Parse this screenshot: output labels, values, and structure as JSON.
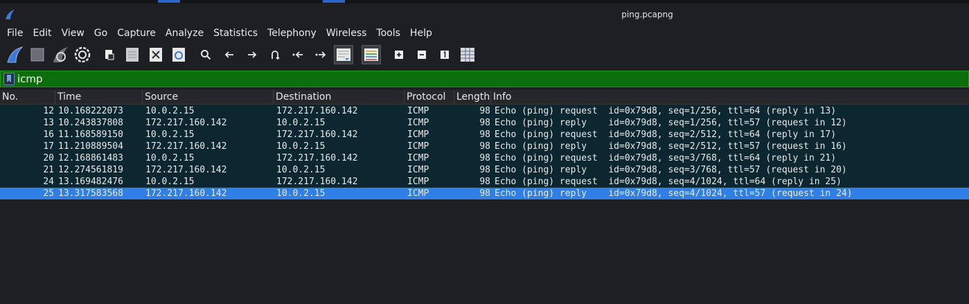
{
  "window": {
    "title": "ping.pcapng"
  },
  "menu": [
    "File",
    "Edit",
    "View",
    "Go",
    "Capture",
    "Analyze",
    "Statistics",
    "Telephony",
    "Wireless",
    "Tools",
    "Help"
  ],
  "toolbar": {
    "icons": [
      "shark-fin-start-icon",
      "stop-square-icon",
      "restart-capture-icon",
      "capture-options-gear-icon",
      "open-file-icon",
      "save-file-icon",
      "close-file-icon",
      "reload-file-icon",
      "find-packet-icon",
      "go-back-icon",
      "go-forward-icon",
      "go-to-packet-icon",
      "go-first-packet-icon",
      "go-last-packet-icon",
      "autoscroll-icon",
      "colorize-icon",
      "zoom-in-icon",
      "zoom-out-icon",
      "normal-size-icon",
      "resize-columns-icon"
    ]
  },
  "filter": {
    "value": "icmp"
  },
  "packet_list": {
    "columns": [
      "No.",
      "Time",
      "Source",
      "Destination",
      "Protocol",
      "Length",
      "Info"
    ],
    "rows": [
      {
        "no": "12",
        "time": "10.168222073",
        "src": "10.0.2.15",
        "dst": "172.217.160.142",
        "proto": "ICMP",
        "len": "98",
        "info": "Echo (ping) request  id=0x79d8, seq=1/256, ttl=64 (reply in 13)"
      },
      {
        "no": "13",
        "time": "10.243837808",
        "src": "172.217.160.142",
        "dst": "10.0.2.15",
        "proto": "ICMP",
        "len": "98",
        "info": "Echo (ping) reply    id=0x79d8, seq=1/256, ttl=57 (request in 12)"
      },
      {
        "no": "16",
        "time": "11.168589150",
        "src": "10.0.2.15",
        "dst": "172.217.160.142",
        "proto": "ICMP",
        "len": "98",
        "info": "Echo (ping) request  id=0x79d8, seq=2/512, ttl=64 (reply in 17)"
      },
      {
        "no": "17",
        "time": "11.210889504",
        "src": "172.217.160.142",
        "dst": "10.0.2.15",
        "proto": "ICMP",
        "len": "98",
        "info": "Echo (ping) reply    id=0x79d8, seq=2/512, ttl=57 (request in 16)"
      },
      {
        "no": "20",
        "time": "12.168861483",
        "src": "10.0.2.15",
        "dst": "172.217.160.142",
        "proto": "ICMP",
        "len": "98",
        "info": "Echo (ping) request  id=0x79d8, seq=3/768, ttl=64 (reply in 21)"
      },
      {
        "no": "21",
        "time": "12.274561819",
        "src": "172.217.160.142",
        "dst": "10.0.2.15",
        "proto": "ICMP",
        "len": "98",
        "info": "Echo (ping) reply    id=0x79d8, seq=3/768, ttl=57 (request in 20)"
      },
      {
        "no": "24",
        "time": "13.169482476",
        "src": "10.0.2.15",
        "dst": "172.217.160.142",
        "proto": "ICMP",
        "len": "98",
        "info": "Echo (ping) request  id=0x79d8, seq=4/1024, ttl=64 (reply in 25)"
      },
      {
        "no": "25",
        "time": "13.317583568",
        "src": "172.217.160.142",
        "dst": "10.0.2.15",
        "proto": "ICMP",
        "len": "98",
        "info": "Echo (ping) reply    id=0x79d8, seq=4/1024, ttl=57 (request in 24)",
        "selected": true
      }
    ]
  },
  "colors": {
    "row_bg": "#0d2730",
    "selected_bg": "#2f7fe6",
    "filter_bg": "#0b6e0b"
  }
}
